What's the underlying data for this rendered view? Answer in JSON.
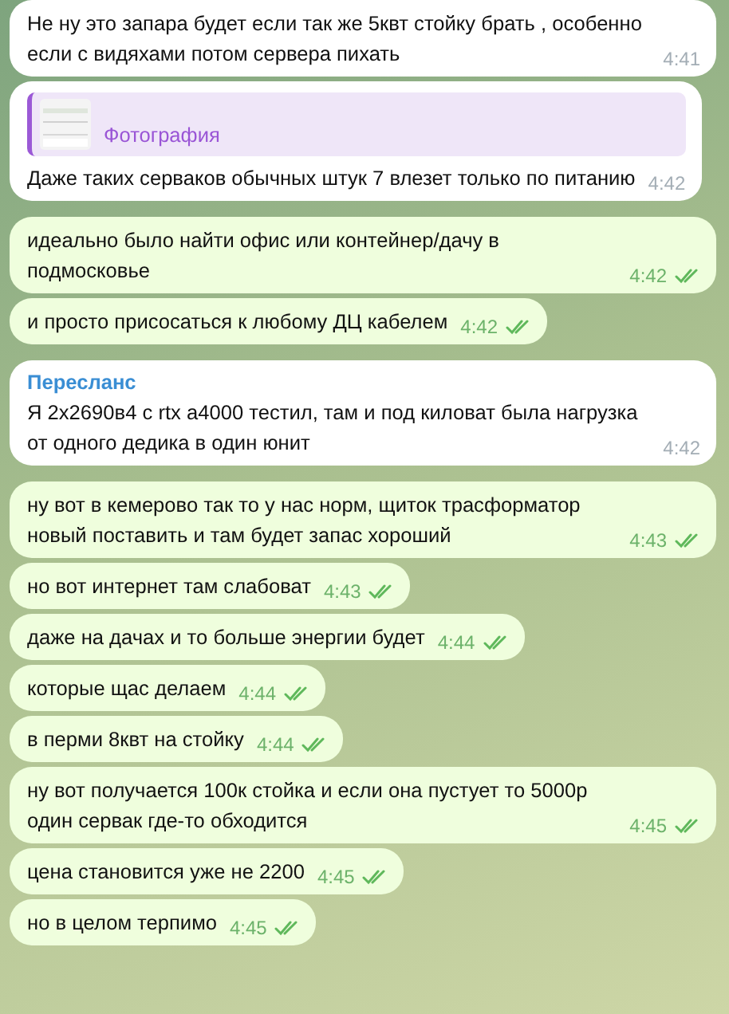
{
  "messages": [
    {
      "kind": "in",
      "text": "Не ну это запара будет если так же 5квт стойку брать , особенно если с видяхами потом сервера пихать",
      "time": "4:41"
    },
    {
      "kind": "in",
      "reply": {
        "kind": "picture",
        "label": "Фотография"
      },
      "text": "Даже таких серваков обычных штук 7 влезет только по питанию",
      "time": "4:42"
    },
    {
      "kind": "out",
      "text": "идеально было найти офис или контейнер/дачу в подмосковье",
      "time": "4:42",
      "read": true
    },
    {
      "kind": "out",
      "text": "и просто присосаться к любому ДЦ кабелем",
      "time": "4:42",
      "read": true
    },
    {
      "kind": "in",
      "sender": "Пересланс",
      "text": "Я 2х2690в4 с rtx a4000 тестил, там и под киловат была нагрузка от одного дедика в один юнит",
      "time": "4:42"
    },
    {
      "kind": "out",
      "text": "ну вот в кемерово так то у нас норм, щиток трасформатор новый поставить и там будет запас хороший",
      "time": "4:43",
      "read": true
    },
    {
      "kind": "out",
      "text": "но вот интернет там слабоват",
      "time": "4:43",
      "read": true
    },
    {
      "kind": "out",
      "text": "даже на дачах и то больше энергии будет",
      "time": "4:44",
      "read": true
    },
    {
      "kind": "out",
      "text": "которые щас делаем",
      "time": "4:44",
      "read": true
    },
    {
      "kind": "out",
      "text": "в перми 8квт на стойку",
      "time": "4:44",
      "read": true
    },
    {
      "kind": "out",
      "text": "ну вот получается 100к стойка и если она пустует то 5000р один сервак где-то обходится",
      "time": "4:45",
      "read": true
    },
    {
      "kind": "out",
      "text": "цена становится уже не 2200",
      "time": "4:45",
      "read": true
    },
    {
      "kind": "out",
      "text": "но в целом терпимо",
      "time": "4:45",
      "read": true
    }
  ]
}
